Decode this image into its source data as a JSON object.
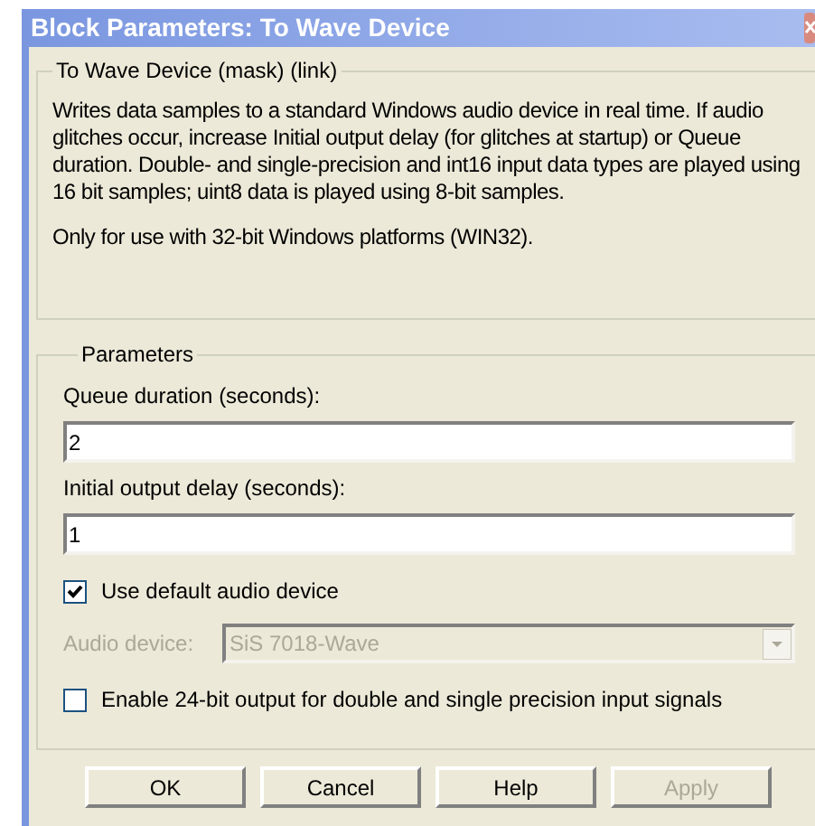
{
  "window": {
    "title": "Block Parameters: To Wave Device"
  },
  "description": {
    "title": "To Wave Device (mask) (link)",
    "paragraphs": [
      "Writes data samples to a standard Windows audio device in real time.  If audio glitches occur, increase Initial output delay (for glitches at startup) or Queue duration.  Double- and single-precision and int16 input data types are played using 16 bit samples; uint8 data is played using 8-bit samples.",
      "Only for use with 32-bit Windows platforms (WIN32)."
    ]
  },
  "parameters": {
    "title": "Parameters",
    "items": [
      {
        "kind": "text",
        "label": "Queue duration (seconds):",
        "value": "2"
      },
      {
        "kind": "text",
        "label": "Initial output delay (seconds):",
        "value": "1"
      },
      {
        "kind": "checkbox",
        "label": "Use default audio device",
        "checked": true
      },
      {
        "kind": "dropdown",
        "label": "Audio device:",
        "value": "SiS 7018-Wave",
        "disabled": true
      },
      {
        "kind": "checkbox",
        "label": "Enable 24-bit output for double and single precision input signals",
        "checked": false
      }
    ]
  },
  "buttons": [
    {
      "label": "OK",
      "disabled": false
    },
    {
      "label": "Cancel",
      "disabled": false
    },
    {
      "label": "Help",
      "disabled": false
    },
    {
      "label": "Apply",
      "disabled": true
    }
  ]
}
